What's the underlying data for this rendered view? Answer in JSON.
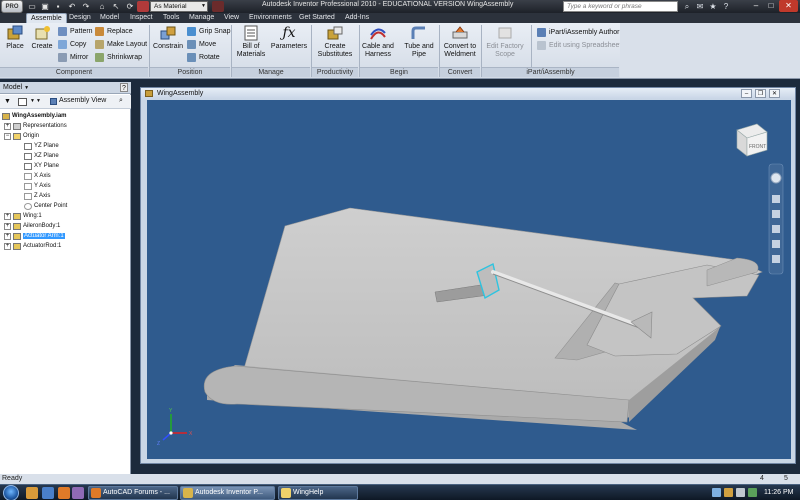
{
  "titlebar": {
    "app_logo": "PRO",
    "material": "As Material",
    "title": "Autodesk Inventor Professional 2010 - EDUCATIONAL VERSION      WingAssembly",
    "search_placeholder": "Type a keyword or phrase"
  },
  "tabs": [
    "Assemble",
    "Design",
    "Model",
    "Inspect",
    "Tools",
    "Manage",
    "View",
    "Environments",
    "Get Started",
    "Add-Ins"
  ],
  "ribbon": {
    "component": {
      "label": "Component",
      "place": "Place",
      "create": "Create",
      "pattern": "Pattern",
      "copy": "Copy",
      "mirror": "Mirror",
      "replace": "Replace",
      "make_layout": "Make Layout",
      "shrinkwrap": "Shrinkwrap"
    },
    "position": {
      "label": "Position",
      "constrain": "Constrain",
      "grip_snap": "Grip Snap",
      "move": "Move",
      "rotate": "Rotate"
    },
    "manage": {
      "label": "Manage",
      "bom_line1": "Bill of",
      "bom_line2": "Materials",
      "parameters": "Parameters"
    },
    "productivity": {
      "label": "Productivity",
      "line1": "Create",
      "line2": "Substitutes"
    },
    "begin": {
      "label": "Begin",
      "cable_line1": "Cable and",
      "cable_line2": "Harness",
      "tube_line1": "Tube and",
      "tube_line2": "Pipe"
    },
    "convert": {
      "label": "Convert",
      "line1": "Convert to",
      "line2": "Weldment"
    },
    "factory": {
      "line1": "Edit Factory",
      "line2": "Scope"
    },
    "ipart": {
      "label": "iPart/iAssembly",
      "author": "iPart/iAssembly Author",
      "edit": "Edit using Spreadsheet"
    }
  },
  "model_panel": {
    "title": "Model",
    "view": "Assembly View",
    "help": "?",
    "tree": [
      {
        "label": "WingAssembly.iam",
        "bold": true
      },
      {
        "label": "Representations"
      },
      {
        "label": "Origin"
      },
      {
        "label": "YZ Plane"
      },
      {
        "label": "XZ Plane"
      },
      {
        "label": "XY Plane"
      },
      {
        "label": "X Axis"
      },
      {
        "label": "Y Axis"
      },
      {
        "label": "Z Axis"
      },
      {
        "label": "Center Point"
      },
      {
        "label": "Wing:1"
      },
      {
        "label": "AileronBody:1"
      },
      {
        "label": "Actuator Arm:1",
        "selected": true
      },
      {
        "label": "ActuatorRod:1"
      }
    ]
  },
  "viewport": {
    "title": "WingAssembly",
    "viewcube_label": "FRONT",
    "axes": {
      "x": "X",
      "y": "Y",
      "z": "Z"
    },
    "colors": {
      "background": "#2f5b8e",
      "part": "#c9c9c9",
      "highlight": "#2ec4e0"
    }
  },
  "status": {
    "text": "Ready",
    "count1": "4",
    "count2": "5"
  },
  "taskbar": {
    "items": [
      "AutoCAD Forums - ...",
      "Autodesk Inventor P...",
      "WingHelp"
    ],
    "clock": "11:26 PM"
  }
}
